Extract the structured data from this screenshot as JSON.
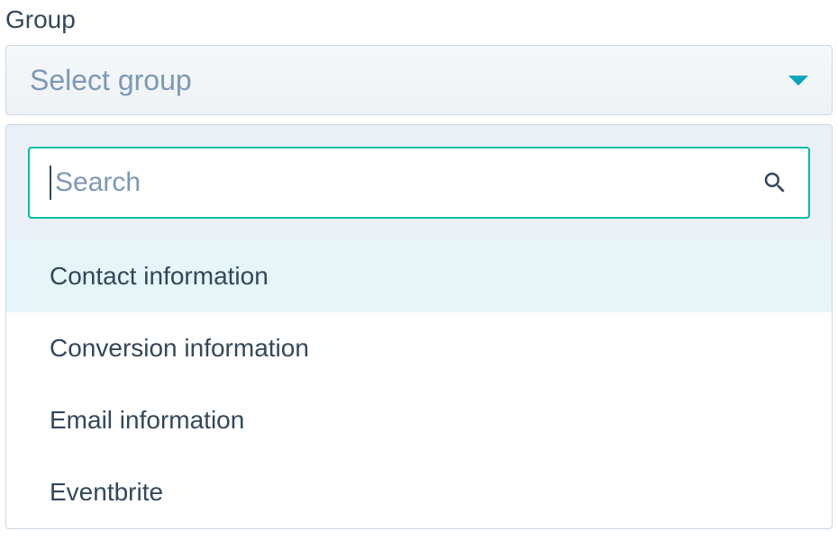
{
  "field": {
    "label": "Group",
    "placeholder": "Select group"
  },
  "search": {
    "placeholder": "Search"
  },
  "options": [
    {
      "label": "Contact information",
      "highlighted": true
    },
    {
      "label": "Conversion information",
      "highlighted": false
    },
    {
      "label": "Email information",
      "highlighted": false
    },
    {
      "label": "Eventbrite",
      "highlighted": false
    }
  ]
}
